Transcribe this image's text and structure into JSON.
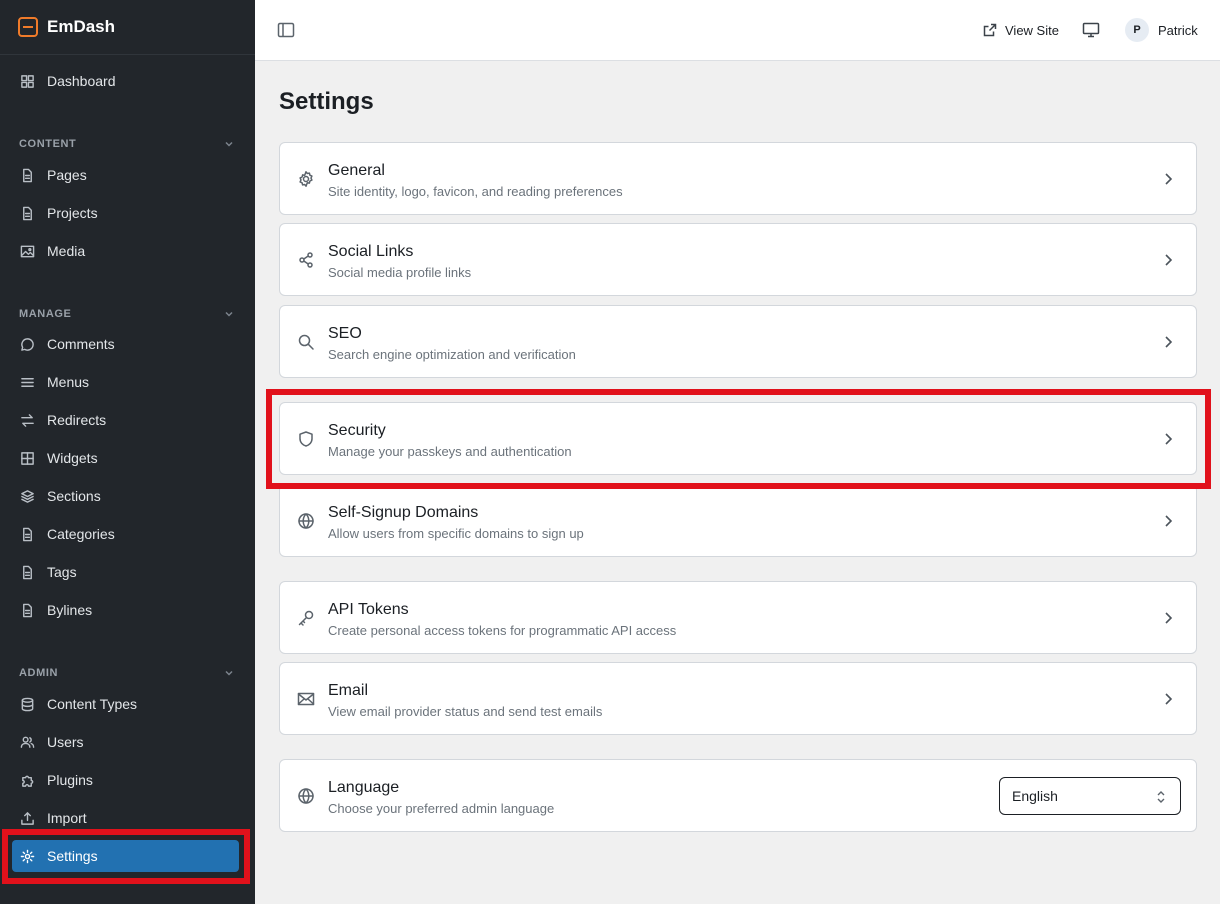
{
  "app": {
    "name": "EmDash"
  },
  "topbar": {
    "view_site": "View Site",
    "user_initial": "P",
    "user_name": "Patrick"
  },
  "sidebar": {
    "dashboard": "Dashboard",
    "sections": {
      "content": "CONTENT",
      "manage": "MANAGE",
      "admin": "ADMIN"
    },
    "content_items": [
      "Pages",
      "Projects",
      "Media"
    ],
    "manage_items": [
      "Comments",
      "Menus",
      "Redirects",
      "Widgets",
      "Sections",
      "Categories",
      "Tags",
      "Bylines"
    ],
    "admin_items": [
      "Content Types",
      "Users",
      "Plugins",
      "Import",
      "Settings"
    ],
    "active": "Settings"
  },
  "page": {
    "title": "Settings",
    "cards": [
      {
        "icon": "gear-icon",
        "title": "General",
        "desc": "Site identity, logo, favicon, and reading preferences"
      },
      {
        "icon": "share-icon",
        "title": "Social Links",
        "desc": "Social media profile links"
      },
      {
        "icon": "search-icon",
        "title": "SEO",
        "desc": "Search engine optimization and verification"
      },
      {
        "icon": "shield-icon",
        "title": "Security",
        "desc": "Manage your passkeys and authentication"
      },
      {
        "icon": "globe-icon",
        "title": "Self-Signup Domains",
        "desc": "Allow users from specific domains to sign up"
      },
      {
        "icon": "key-icon",
        "title": "API Tokens",
        "desc": "Create personal access tokens for programmatic API access"
      },
      {
        "icon": "mail-icon",
        "title": "Email",
        "desc": "View email provider status and send test emails"
      }
    ],
    "language": {
      "icon": "globe-icon",
      "title": "Language",
      "desc": "Choose your preferred admin language",
      "selected": "English"
    }
  },
  "colors": {
    "sidebar_bg": "#22262b",
    "active_item": "#2271b1",
    "brand_accent": "#f07b2a",
    "highlight": "#e1111b"
  }
}
